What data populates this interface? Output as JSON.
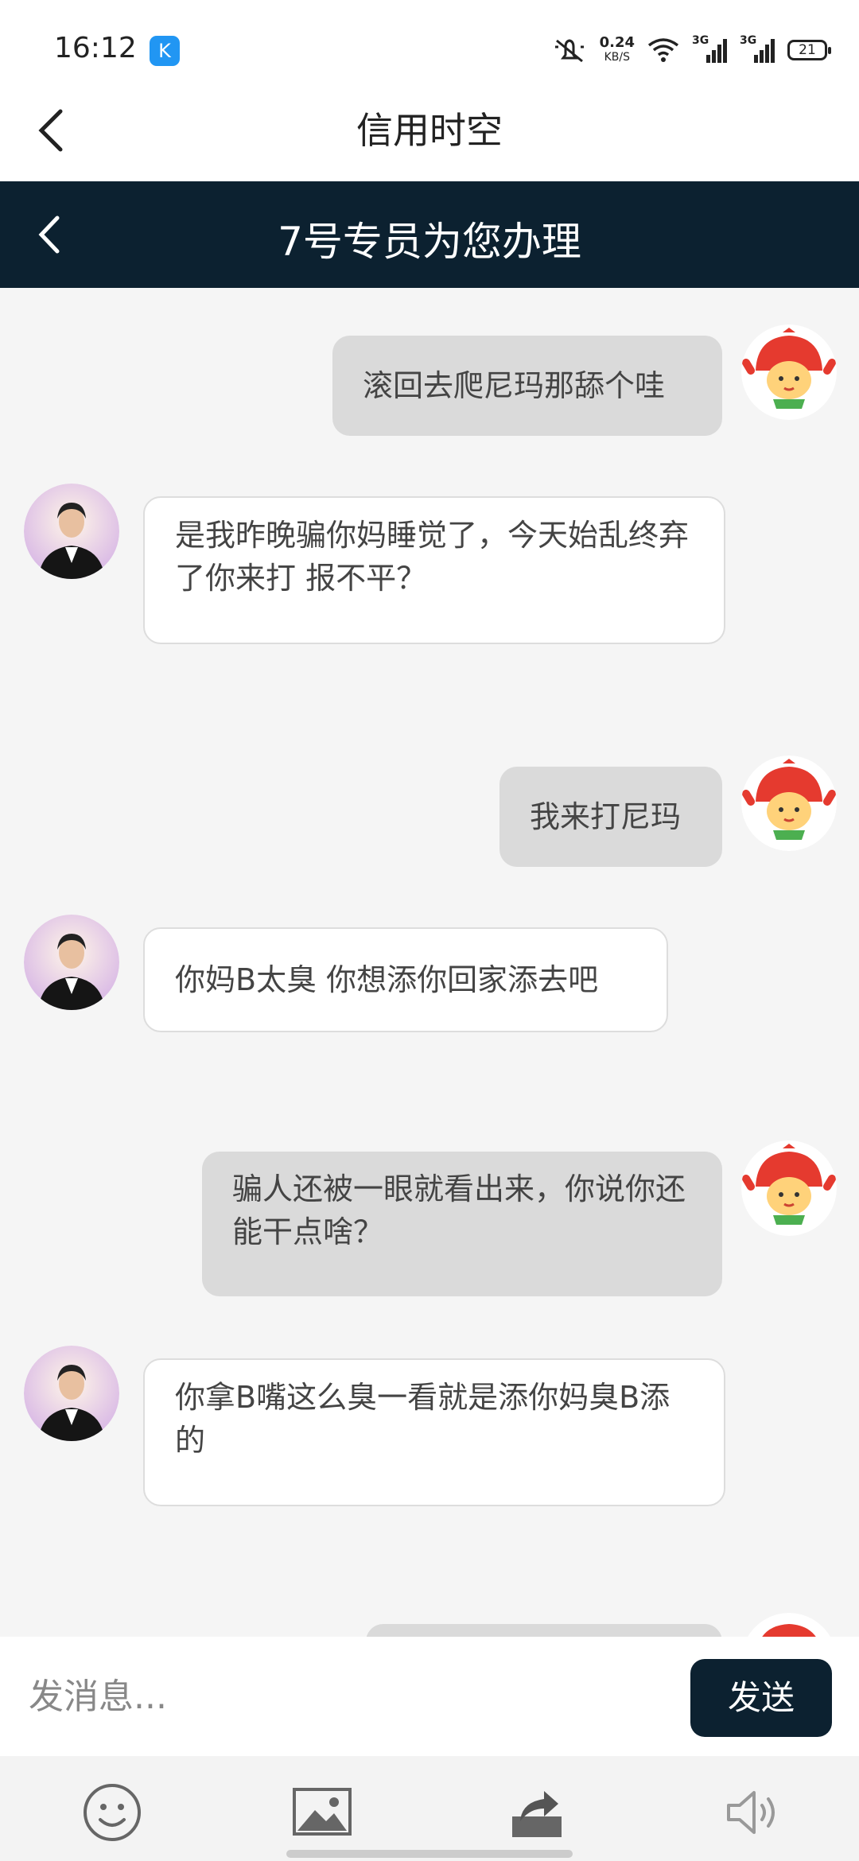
{
  "status_bar": {
    "time": "16:12",
    "app_icon_letter": "K",
    "net_speed_value": "0.24",
    "net_speed_unit": "KB/S",
    "signal1_label": "3G",
    "signal2_label": "3G",
    "battery": "21"
  },
  "app_bar": {
    "title": "信用时空"
  },
  "sub_bar": {
    "title": "7号专员为您办理"
  },
  "messages": [
    {
      "sender": "user",
      "text": "滚回去爬尼玛那舔个哇"
    },
    {
      "sender": "agent",
      "text": "是我昨晚骗你妈睡觉了，今天始乱终弃了你来打 报不平？"
    },
    {
      "sender": "user",
      "text": "我来打尼玛"
    },
    {
      "sender": "agent",
      "text": "你妈B太臭 你想添你回家添去吧"
    },
    {
      "sender": "user",
      "text": "骗人还被一眼就看出来，你说你还能干点啥？"
    },
    {
      "sender": "agent",
      "text": "你拿B嘴这么臭一看就是添你妈臭B添的"
    },
    {
      "sender": "user",
      "text": ""
    }
  ],
  "composer": {
    "placeholder": "发消息...",
    "value": "",
    "send_label": "发送"
  },
  "toolbar": {
    "icons": [
      "emoji-icon",
      "image-icon",
      "share-icon",
      "speaker-icon"
    ]
  },
  "colors": {
    "header_dark": "#0c2130",
    "user_bubble": "#dadada",
    "agent_bubble": "#ffffff",
    "background": "#f5f5f5"
  }
}
